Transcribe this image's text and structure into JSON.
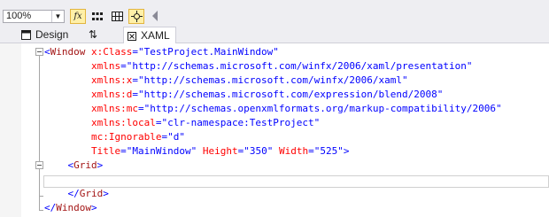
{
  "toolbar": {
    "zoom_value": "100%",
    "buttons": [
      {
        "name": "formula-button",
        "icon": "fx-icon"
      },
      {
        "name": "show-grid-button",
        "icon": "grid-icon"
      },
      {
        "name": "gridlines-button",
        "icon": "gridlines-icon"
      },
      {
        "name": "snap-button",
        "icon": "snap-crosshair-icon"
      }
    ]
  },
  "tabs": {
    "design": "Design",
    "swap_glyph": "⇅",
    "xaml": "XAML"
  },
  "code": {
    "l1": {
      "open": "<",
      "tag": "Window",
      "attr": "x:Class",
      "eq": "=",
      "val": "\"TestProject.MainWindow\""
    },
    "l2": {
      "attr": "xmlns",
      "eq": "=",
      "val": "\"http://schemas.microsoft.com/winfx/2006/xaml/presentation\""
    },
    "l3": {
      "attr": "xmlns:x",
      "eq": "=",
      "val": "\"http://schemas.microsoft.com/winfx/2006/xaml\""
    },
    "l4": {
      "attr": "xmlns:d",
      "eq": "=",
      "val": "\"http://schemas.microsoft.com/expression/blend/2008\""
    },
    "l5": {
      "attr": "xmlns:mc",
      "eq": "=",
      "val": "\"http://schemas.openxmlformats.org/markup-compatibility/2006\""
    },
    "l6": {
      "attr": "xmlns:local",
      "eq": "=",
      "val": "\"clr-namespace:TestProject\""
    },
    "l7": {
      "attr": "mc:Ignorable",
      "eq": "=",
      "val": "\"d\""
    },
    "l8": {
      "a1": "Title",
      "v1": "\"MainWindow\"",
      "a2": "Height",
      "v2": "\"350\"",
      "a3": "Width",
      "v3": "\"525\"",
      "eq": "=",
      "close": ">"
    },
    "l9": {
      "open": "<",
      "tag": "Grid",
      "close": ">"
    },
    "l11": {
      "open": "</",
      "tag": "Grid",
      "close": ">"
    },
    "l12": {
      "open": "</",
      "tag": "Window",
      "close": ">"
    }
  },
  "colors": {
    "bracket": "#0000ff",
    "element": "#a31515",
    "attribute": "#ff0000",
    "value": "#0000ff",
    "toggle_bg": "#fff0a8"
  }
}
